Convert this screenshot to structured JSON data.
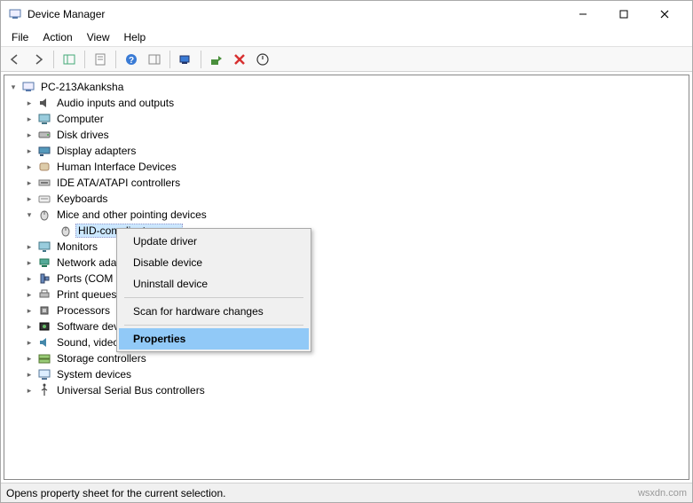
{
  "window": {
    "title": "Device Manager"
  },
  "menubar": {
    "file": "File",
    "action": "Action",
    "view": "View",
    "help": "Help"
  },
  "tree": {
    "root": "PC-213Akanksha",
    "nodes": {
      "audio": "Audio inputs and outputs",
      "computer": "Computer",
      "disk": "Disk drives",
      "display": "Display adapters",
      "hid": "Human Interface Devices",
      "ide": "IDE ATA/ATAPI controllers",
      "keyboard": "Keyboards",
      "mice": "Mice and other pointing devices",
      "hidmouse": "HID-compliant mouse",
      "monitors": "Monitors",
      "network": "Network ada",
      "ports": "Ports (COM",
      "printq": "Print queues",
      "processors": "Processors",
      "software": "Software dev",
      "sound": "Sound, video",
      "storage": "Storage controllers",
      "system": "System devices",
      "usb": "Universal Serial Bus controllers"
    }
  },
  "context_menu": {
    "update": "Update driver",
    "disable": "Disable device",
    "uninstall": "Uninstall device",
    "scan": "Scan for hardware changes",
    "properties": "Properties"
  },
  "statusbar": {
    "text": "Opens property sheet for the current selection.",
    "watermark": "wsxdn.com"
  }
}
